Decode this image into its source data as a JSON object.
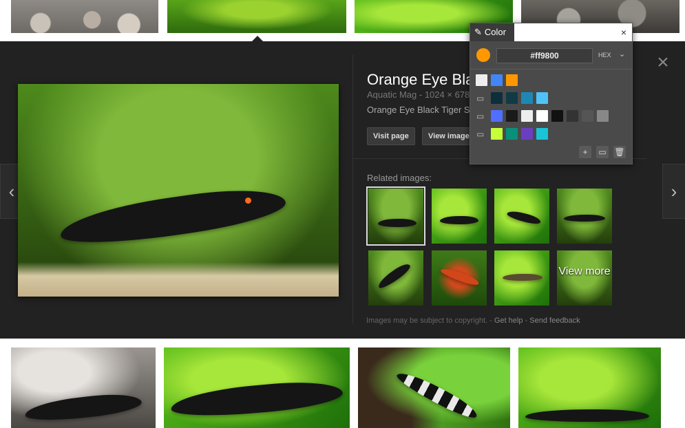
{
  "detail": {
    "title": "Orange Eye Bla",
    "source": "Aquatic Mag",
    "dimensions": "1024 × 678",
    "caption": "Orange Eye Black Tiger S",
    "visit_page_label": "Visit page",
    "view_image_label": "View image",
    "related_label": "Related images:",
    "view_more_label": "View more",
    "footer_notice": "Images may be subject to copyright.",
    "footer_help": "Get help",
    "footer_feedback": "Send feedback",
    "footer_sep1": "-",
    "footer_sep2": "-",
    "prev_arrow": "‹",
    "next_arrow": "›",
    "close_glyph": "×"
  },
  "picker": {
    "title": "Color",
    "close_glyph": "×",
    "hex_value": "#ff9800",
    "format_label": "HEX",
    "chevron": "⌄",
    "current_color": "#ff9800",
    "row1": [
      "#eeeeee",
      "#4285f4",
      "#ff9800"
    ],
    "row2": [
      "#0d2e3a",
      "#103a44",
      "#1e88b4",
      "#4fc3f7"
    ],
    "row3": [
      "#4f6fff",
      "#1a1a1a",
      "#eeeeee",
      "#ffffff",
      "#111111",
      "#333333",
      "#555555",
      "#888888"
    ],
    "row4": [
      "#c6ff3a",
      "#0a8f7a",
      "#6a3fbf",
      "#18c4d6"
    ],
    "tools": [
      "add-icon",
      "folder-icon",
      "trash-icon"
    ]
  },
  "icons": [
    "chevron-left-icon",
    "chevron-right-icon",
    "close-icon",
    "eyedropper-icon",
    "folder-icon"
  ]
}
